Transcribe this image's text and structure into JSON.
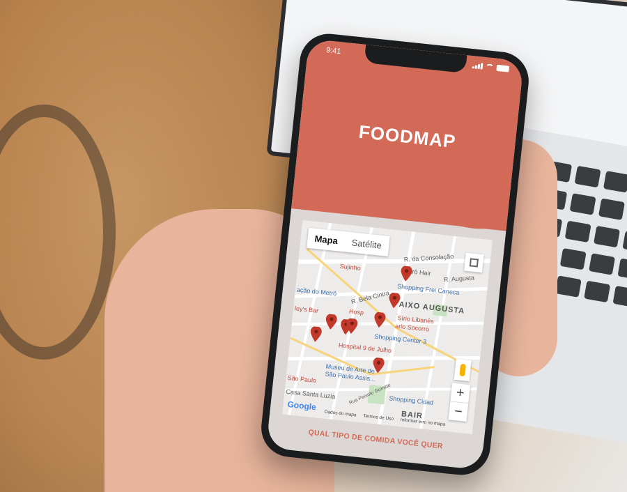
{
  "status": {
    "time": "9:41"
  },
  "app": {
    "title": "FOODMAP"
  },
  "map": {
    "tabs": [
      "Mapa",
      "Satélite"
    ],
    "places": {
      "consolacao": "R. da Consolação",
      "sujinho": "Sujinho",
      "retro_hair": "Retrô Hair",
      "augusta_st": "R. Augusta",
      "shopping_frei": "Shopping Frei Caneca",
      "metro": "ação do Metrô",
      "bela_cintra": "R. Bela Cintra",
      "baixo_augusta": "AIXO AUGUSTA",
      "leys_bar": "ley's Bar",
      "hosp": "Hosp",
      "sirio": "Sírio Libanês",
      "socorro": "ario Socorro",
      "shopping_center3": "Shopping Center 3",
      "hospital_9": "Hospital 9 de Julho",
      "museu1": "Museu de Arte de",
      "museu2": "São Paulo Assis...",
      "sao_paulo": "São Paulo",
      "casa_santa": "Casa Santa Luzia",
      "shopping_cidade": "Shopping Cidad",
      "bairro": "BAIR",
      "peixoto": "Rua Peixoto Gomide"
    },
    "google": "Google",
    "footer": [
      "Dados do mapa",
      "Termos de Uso",
      "Informar erro no mapa"
    ]
  },
  "question": "QUAL TIPO DE COMIDA VOCÊ QUER",
  "colors": {
    "brand": "#d26a57",
    "pin": "#c0392b",
    "screen_bg": "#dcd7d4"
  },
  "icons": [
    "fullscreen-icon",
    "pegman-icon",
    "zoom-in-icon",
    "zoom-out-icon",
    "map-pin-icon"
  ]
}
